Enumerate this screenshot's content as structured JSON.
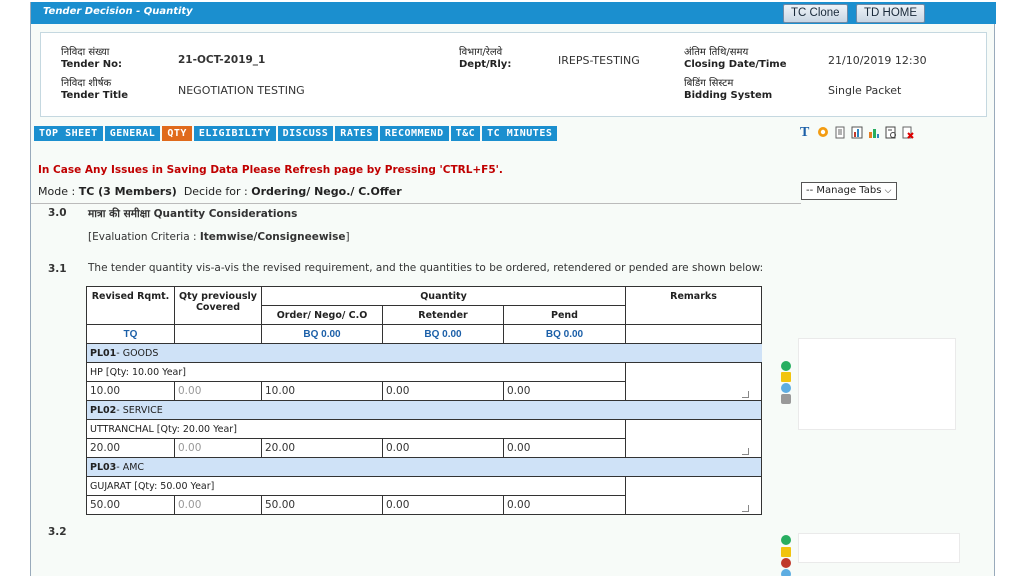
{
  "title": "Tender Decision - Quantity",
  "buttons": {
    "tc_clone": "TC Clone",
    "td_home": "TD HOME"
  },
  "header": {
    "tender_no_hi": "निविदा संख्या",
    "tender_no_en": "Tender No:",
    "tender_no": "21-OCT-2019_1",
    "tender_title_hi": "निविदा शीर्षक",
    "tender_title_en": "Tender Title",
    "tender_title": "NEGOTIATION TESTING",
    "dept_hi": "विभाग/रेलवे",
    "dept_en": "Dept/Rly:",
    "dept": "IREPS-TESTING",
    "closing_hi": "अंतिम तिथि/समय",
    "closing_en": "Closing Date/Time",
    "closing": "21/10/2019 12:30",
    "bidding_hi": "बिडिंग सिस्टम",
    "bidding_en": "Bidding System",
    "bidding": "Single Packet"
  },
  "tabs": [
    "TOP SHEET",
    "GENERAL",
    "QTY",
    "ELIGIBILITY",
    "DISCUSS",
    "RATES",
    "RECOMMEND",
    "T&C",
    "TC MINUTES"
  ],
  "active_tab": "QTY",
  "toolbar_icons": [
    "text-icon",
    "refresh-icon",
    "document-icon",
    "chart-icon",
    "bars-icon",
    "report-icon",
    "close-doc-icon"
  ],
  "warning": "In Case Any Issues in Saving Data Please Refresh page by Pressing 'CTRL+F5'.",
  "mode": {
    "label": "Mode :",
    "value": "TC (3 Members)",
    "decide_label": "Decide for :",
    "decide_value": "Ordering/ Nego./ C.Offer"
  },
  "manage_tabs": "-- Manage Tabs",
  "section_3_0": {
    "num": "3.0",
    "title": "मात्रा की समीक्षा Quantity Considerations",
    "criteria_prefix": "[Evaluation Criteria :",
    "criteria_value": "Itemwise/Consigneewise",
    "criteria_suffix": "]"
  },
  "section_3_1": {
    "num": "3.1",
    "text": "The tender quantity vis-a-vis the revised requirement, and the quantities to be ordered, retendered or pended are shown below:"
  },
  "section_3_2": {
    "num": "3.2"
  },
  "table": {
    "headers": {
      "revised": "Revised Rqmt.",
      "qty_prev": "Qty previously Covered",
      "quantity": "Quantity",
      "remarks": "Remarks",
      "order": "Order/ Nego/ C.O",
      "retender": "Retender",
      "pend": "Pend"
    },
    "tq": "TQ",
    "bq_order": "BQ   0.00",
    "bq_retender": "BQ   0.00",
    "bq_pend": "BQ   0.00",
    "groups": [
      {
        "pl": "PL01",
        "name": "GOODS",
        "consignee": "HP  [Qty: 10.00  Year]",
        "revised": "10.00",
        "prev": "0.00",
        "order": "10.00",
        "retender": "0.00",
        "pend": "0.00"
      },
      {
        "pl": "PL02",
        "name": "SERVICE",
        "consignee": "UTTRANCHAL  [Qty: 20.00  Year]",
        "revised": "20.00",
        "prev": "0.00",
        "order": "20.00",
        "retender": "0.00",
        "pend": "0.00"
      },
      {
        "pl": "PL03",
        "name": "AMC",
        "consignee": "GUJARAT  [Qty: 50.00  Year]",
        "revised": "50.00",
        "prev": "0.00",
        "order": "50.00",
        "retender": "0.00",
        "pend": "0.00"
      }
    ]
  }
}
